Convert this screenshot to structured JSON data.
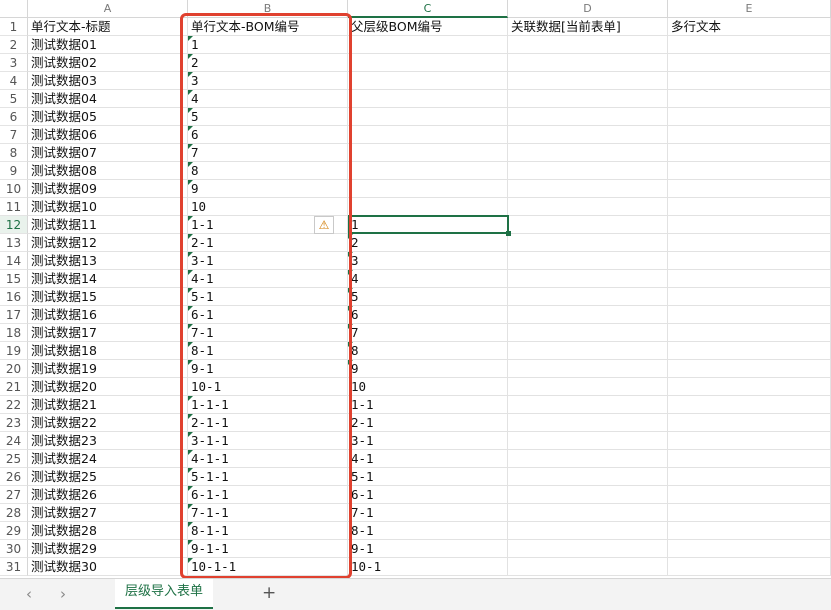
{
  "columns": [
    {
      "letter": "A",
      "selected": false
    },
    {
      "letter": "B",
      "selected": false
    },
    {
      "letter": "C",
      "selected": true
    },
    {
      "letter": "D",
      "selected": false
    },
    {
      "letter": "E",
      "selected": false
    }
  ],
  "selected_row": 12,
  "rows": [
    {
      "num": "1",
      "A": "单行文本-标题",
      "B": "单行文本-BOM编号",
      "C": "父层级BOM编号",
      "D": "关联数据[当前表单]",
      "E": "多行文本"
    },
    {
      "num": "2",
      "A": "测试数据01",
      "B": "1",
      "C": ""
    },
    {
      "num": "3",
      "A": "测试数据02",
      "B": "2",
      "C": ""
    },
    {
      "num": "4",
      "A": "测试数据03",
      "B": "3",
      "C": ""
    },
    {
      "num": "5",
      "A": "测试数据04",
      "B": "4",
      "C": ""
    },
    {
      "num": "6",
      "A": "测试数据05",
      "B": "5",
      "C": ""
    },
    {
      "num": "7",
      "A": "测试数据06",
      "B": "6",
      "C": ""
    },
    {
      "num": "8",
      "A": "测试数据07",
      "B": "7",
      "C": ""
    },
    {
      "num": "9",
      "A": "测试数据08",
      "B": "8",
      "C": ""
    },
    {
      "num": "10",
      "A": "测试数据09",
      "B": "9",
      "C": ""
    },
    {
      "num": "11",
      "A": "测试数据10",
      "B": "10",
      "C": ""
    },
    {
      "num": "12",
      "A": "测试数据11",
      "B": "1-1",
      "C": "1"
    },
    {
      "num": "13",
      "A": "测试数据12",
      "B": "2-1",
      "C": "2"
    },
    {
      "num": "14",
      "A": "测试数据13",
      "B": "3-1",
      "C": "3"
    },
    {
      "num": "15",
      "A": "测试数据14",
      "B": "4-1",
      "C": "4"
    },
    {
      "num": "16",
      "A": "测试数据15",
      "B": "5-1",
      "C": "5"
    },
    {
      "num": "17",
      "A": "测试数据16",
      "B": "6-1",
      "C": "6"
    },
    {
      "num": "18",
      "A": "测试数据17",
      "B": "7-1",
      "C": "7"
    },
    {
      "num": "19",
      "A": "测试数据18",
      "B": "8-1",
      "C": "8"
    },
    {
      "num": "20",
      "A": "测试数据19",
      "B": "9-1",
      "C": "9"
    },
    {
      "num": "21",
      "A": "测试数据20",
      "B": "10-1",
      "C": "10"
    },
    {
      "num": "22",
      "A": "测试数据21",
      "B": "1-1-1",
      "C": "1-1"
    },
    {
      "num": "23",
      "A": "测试数据22",
      "B": "2-1-1",
      "C": "2-1"
    },
    {
      "num": "24",
      "A": "测试数据23",
      "B": "3-1-1",
      "C": "3-1"
    },
    {
      "num": "25",
      "A": "测试数据24",
      "B": "4-1-1",
      "C": "4-1"
    },
    {
      "num": "26",
      "A": "测试数据25",
      "B": "5-1-1",
      "C": "5-1"
    },
    {
      "num": "27",
      "A": "测试数据26",
      "B": "6-1-1",
      "C": "6-1"
    },
    {
      "num": "28",
      "A": "测试数据27",
      "B": "7-1-1",
      "C": "7-1"
    },
    {
      "num": "29",
      "A": "测试数据28",
      "B": "8-1-1",
      "C": "8-1"
    },
    {
      "num": "30",
      "A": "测试数据29",
      "B": "9-1-1",
      "C": "9-1"
    },
    {
      "num": "31",
      "A": "测试数据30",
      "B": "10-1-1",
      "C": "10-1"
    }
  ],
  "warning_icon": "warning-icon",
  "tabbar": {
    "prev_label": "‹",
    "next_label": "›",
    "sheet_tab": "层级导入表单",
    "add_label": "+"
  },
  "colors": {
    "accent": "#1e7145",
    "highlight": "#e0412f"
  }
}
